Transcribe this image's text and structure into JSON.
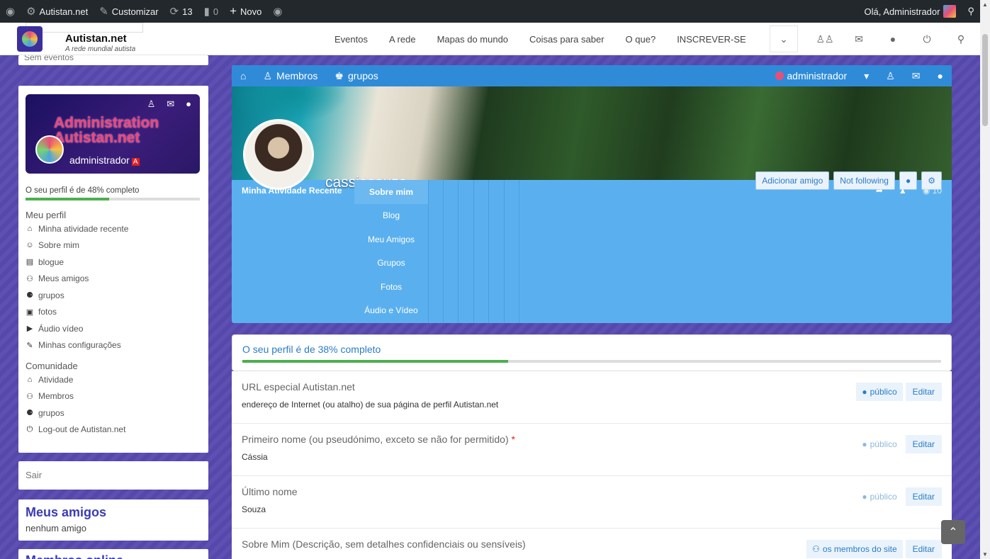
{
  "adminbar": {
    "site_name": "Autistan.net",
    "customize": "Customizar",
    "updates": "13",
    "comments": "0",
    "new": "Novo",
    "greeting": "Olá, Administrador"
  },
  "header": {
    "site_title": "Autistan.net",
    "site_sub": "A rede mundial autista",
    "nav": [
      "Eventos",
      "A rede",
      "Mapas do mundo",
      "Coisas para saber",
      "O que?",
      "INSCREVER-SE"
    ]
  },
  "sidebar": {
    "top_fragment": "Sem eventos",
    "banner_title_1": "Administration",
    "banner_title_2": "Autistan.net",
    "banner_name": "administrador",
    "progress_text": "O seu perfil é de 48% completo",
    "progress_value": 48,
    "section_profile": "Meu perfil",
    "profile_links": [
      {
        "label": "Minha atividade recente",
        "icon": "home-icon",
        "glyph": "⌂"
      },
      {
        "label": "Sobre mim",
        "icon": "user-icon",
        "glyph": "☺"
      },
      {
        "label": "blogue",
        "icon": "file-icon",
        "glyph": "▤"
      },
      {
        "label": "Meus amigos",
        "icon": "users-icon",
        "glyph": "⚇"
      },
      {
        "label": "grupos",
        "icon": "groups-icon",
        "glyph": "⚈"
      },
      {
        "label": "fotos",
        "icon": "camera-icon",
        "glyph": "▣"
      },
      {
        "label": "Áudio vídeo",
        "icon": "video-icon",
        "glyph": "▶"
      },
      {
        "label": "Minhas configurações",
        "icon": "edit-icon",
        "glyph": "✎"
      }
    ],
    "section_community": "Comunidade",
    "community_links": [
      {
        "label": "Atividade",
        "icon": "home-icon",
        "glyph": "⌂"
      },
      {
        "label": "Membros",
        "icon": "users-icon",
        "glyph": "⚇"
      },
      {
        "label": "grupos",
        "icon": "groups-icon",
        "glyph": "⚈"
      },
      {
        "label": "Log-out de Autistan.net",
        "icon": "power-icon",
        "glyph": "⏻"
      }
    ],
    "sair": "Sair",
    "friends_title": "Meus amigos",
    "friends_sub": "nenhum amigo",
    "online_title": "Membros online"
  },
  "cover": {
    "bar_members": "Membros",
    "bar_groups": "grupos",
    "bar_user": "administrador",
    "username": "cassiasouza",
    "btn_add_friend": "Adicionar amigo",
    "btn_following": "Not following",
    "views": "10",
    "activity": "Minha Atividade Recente",
    "menu": [
      "Sobre mim",
      "Blog",
      "Meu Amigos",
      "Grupos",
      "Fotos",
      "Áudio e Vídeo"
    ]
  },
  "profile": {
    "progress_text": "O seu perfil é de 38% completo",
    "progress_value": 38,
    "fields": [
      {
        "label": "URL especial Autistan.net",
        "required": false,
        "value": "endereço de Internet (ou atalho) de sua página de perfil Autistan.net",
        "visibility": "público",
        "edit": "Editar",
        "vis_style": "boxed"
      },
      {
        "label": "Primeiro nome (ou pseudónimo, exceto se não for permitido)",
        "required": true,
        "value": "Cássia",
        "visibility": "público",
        "edit": "Editar",
        "vis_style": "plain"
      },
      {
        "label": "Último nome",
        "required": false,
        "value": "Souza",
        "visibility": "público",
        "edit": "Editar",
        "vis_style": "plain"
      },
      {
        "label": "Sobre Mim (Descrição, sem detalhes confidenciais ou sensíveis)",
        "required": false,
        "value": "",
        "visibility": "os membros do site",
        "edit": "Editar",
        "vis_style": "boxed"
      }
    ]
  },
  "colors": {
    "accent": "#2f8bd8",
    "cover_bg": "#5ab0ef",
    "page_bg": "#5a4db0",
    "progress": "#4caf50"
  }
}
